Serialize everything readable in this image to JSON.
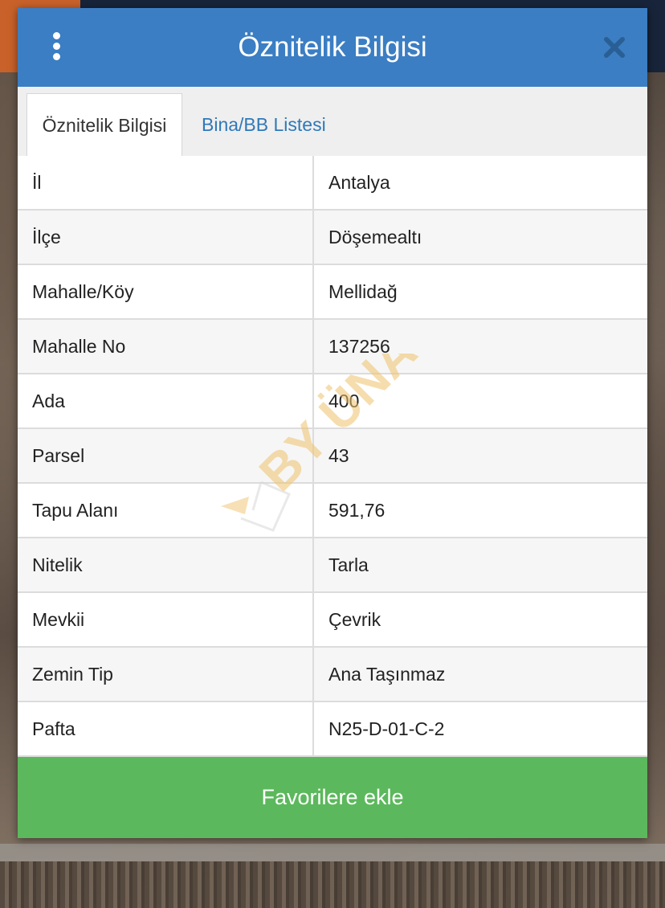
{
  "dialog": {
    "title": "Öznitelik Bilgisi",
    "menu_icon": "kebab-menu-icon",
    "close_icon": "close-icon"
  },
  "tabs": [
    {
      "label": "Öznitelik Bilgisi",
      "active": true
    },
    {
      "label": "Bina/BB Listesi",
      "active": false
    }
  ],
  "attributes": [
    {
      "key": "İl",
      "value": "Antalya"
    },
    {
      "key": "İlçe",
      "value": "Döşemealtı"
    },
    {
      "key": "Mahalle/Köy",
      "value": "Mellidağ"
    },
    {
      "key": "Mahalle No",
      "value": "137256"
    },
    {
      "key": "Ada",
      "value": "400"
    },
    {
      "key": "Parsel",
      "value": "43"
    },
    {
      "key": "Tapu Alanı",
      "value": "591,76"
    },
    {
      "key": "Nitelik",
      "value": "Tarla"
    },
    {
      "key": "Mevkii",
      "value": "Çevrik"
    },
    {
      "key": "Zemin Tip",
      "value": "Ana Taşınmaz"
    },
    {
      "key": "Pafta",
      "value": "N25-D-01-C-2"
    }
  ],
  "actions": {
    "favorite_label": "Favorilere ekle"
  },
  "watermark": {
    "text": "BY ÜNAL"
  },
  "colors": {
    "header": "#3b7ec3",
    "tab_link": "#2f79b9",
    "favorite_button": "#5cb85c"
  }
}
